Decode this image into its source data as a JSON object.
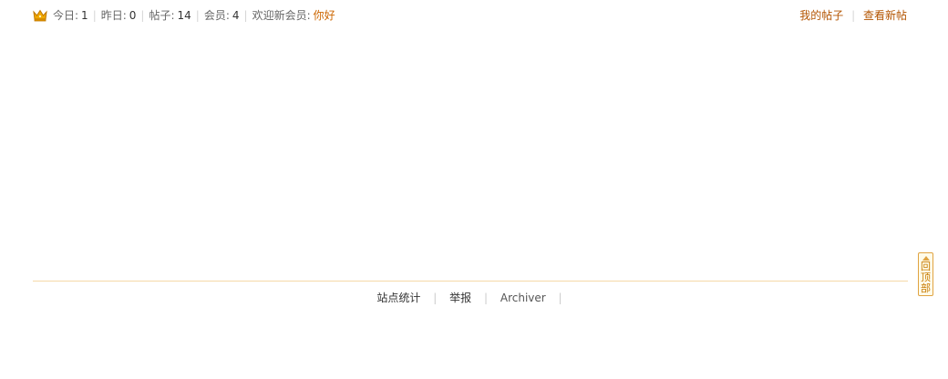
{
  "stats": {
    "today_label": "今日:",
    "today_value": "1",
    "yesterday_label": "昨日:",
    "yesterday_value": "0",
    "posts_label": "帖子:",
    "posts_value": "14",
    "members_label": "会员:",
    "members_value": "4",
    "welcome_label": "欢迎新会员:",
    "newest_member": "你好",
    "icon": "crown-icon",
    "separator": "|"
  },
  "user_links": {
    "my_posts": "我的帖子",
    "separator": "|",
    "new_posts": "查看新帖"
  },
  "footer": {
    "links": [
      "站点统计",
      "举报",
      "Archiver"
    ],
    "separator": "|"
  },
  "back_to_top": {
    "label": "回顶部",
    "icon": "arrow-up-icon"
  },
  "colors": {
    "accent": "#cc6600",
    "link_orange": "#b35400",
    "rule": "#f5d9a8",
    "back_top_border": "#e0a341"
  }
}
